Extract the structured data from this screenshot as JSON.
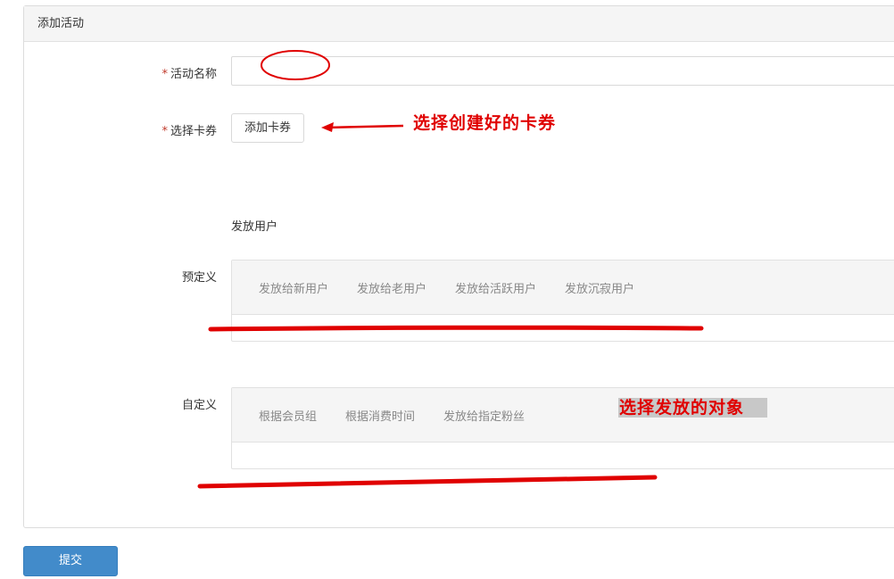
{
  "panel": {
    "title": "添加活动"
  },
  "form": {
    "activity_name": {
      "required_mark": "*",
      "label": "活动名称",
      "value": ""
    },
    "select_card": {
      "required_mark": "*",
      "label": "选择卡券",
      "button_label": "添加卡券"
    },
    "distribute_users_title": "发放用户",
    "predefined": {
      "label": "预定义",
      "tabs": [
        "发放给新用户",
        "发放给老用户",
        "发放给活跃用户",
        "发放沉寂用户"
      ]
    },
    "custom": {
      "label": "自定义",
      "tabs": [
        "根据会员组",
        "根据消费时间",
        "发放给指定粉丝"
      ]
    }
  },
  "submit_label": "提交",
  "annotations": {
    "card_hint": "选择创建好的卡券",
    "target_hint": "选择发放的对象",
    "color": "#e00000"
  }
}
